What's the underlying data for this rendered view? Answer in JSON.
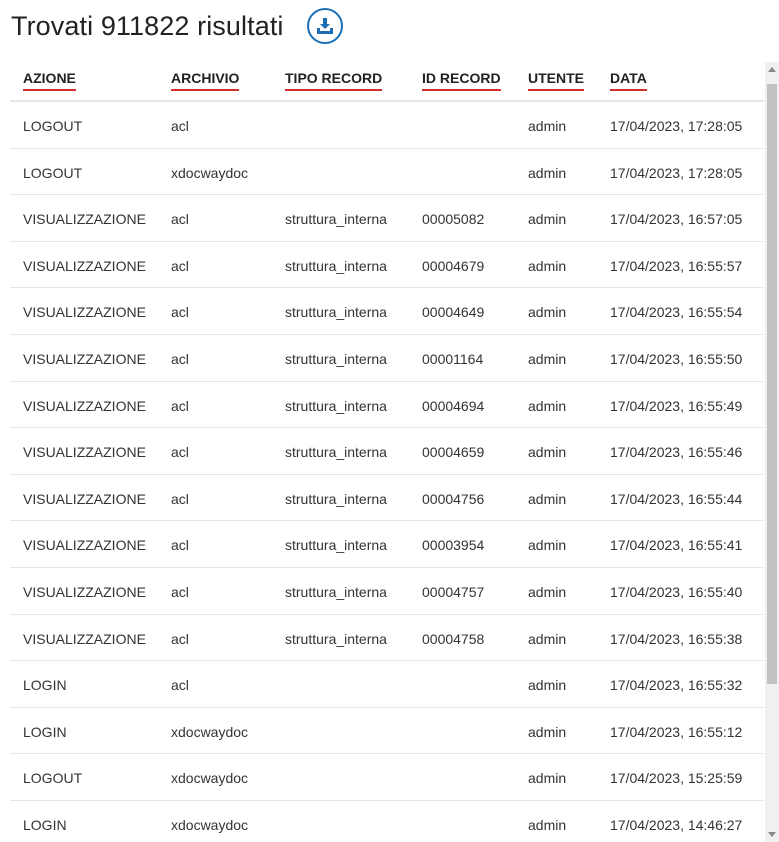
{
  "header": {
    "title": "Trovati 911822 risultati",
    "download_icon": "download-icon"
  },
  "table": {
    "columns": [
      "AZIONE",
      "ARCHIVIO",
      "TIPO RECORD",
      "ID RECORD",
      "UTENTE",
      "DATA"
    ],
    "rows": [
      [
        "LOGOUT",
        "acl",
        "",
        "",
        "admin",
        "17/04/2023, 17:28:05"
      ],
      [
        "LOGOUT",
        "xdocwaydoc",
        "",
        "",
        "admin",
        "17/04/2023, 17:28:05"
      ],
      [
        "VISUALIZZAZIONE",
        "acl",
        "struttura_interna",
        "00005082",
        "admin",
        "17/04/2023, 16:57:05"
      ],
      [
        "VISUALIZZAZIONE",
        "acl",
        "struttura_interna",
        "00004679",
        "admin",
        "17/04/2023, 16:55:57"
      ],
      [
        "VISUALIZZAZIONE",
        "acl",
        "struttura_interna",
        "00004649",
        "admin",
        "17/04/2023, 16:55:54"
      ],
      [
        "VISUALIZZAZIONE",
        "acl",
        "struttura_interna",
        "00001164",
        "admin",
        "17/04/2023, 16:55:50"
      ],
      [
        "VISUALIZZAZIONE",
        "acl",
        "struttura_interna",
        "00004694",
        "admin",
        "17/04/2023, 16:55:49"
      ],
      [
        "VISUALIZZAZIONE",
        "acl",
        "struttura_interna",
        "00004659",
        "admin",
        "17/04/2023, 16:55:46"
      ],
      [
        "VISUALIZZAZIONE",
        "acl",
        "struttura_interna",
        "00004756",
        "admin",
        "17/04/2023, 16:55:44"
      ],
      [
        "VISUALIZZAZIONE",
        "acl",
        "struttura_interna",
        "00003954",
        "admin",
        "17/04/2023, 16:55:41"
      ],
      [
        "VISUALIZZAZIONE",
        "acl",
        "struttura_interna",
        "00004757",
        "admin",
        "17/04/2023, 16:55:40"
      ],
      [
        "VISUALIZZAZIONE",
        "acl",
        "struttura_interna",
        "00004758",
        "admin",
        "17/04/2023, 16:55:38"
      ],
      [
        "LOGIN",
        "acl",
        "",
        "",
        "admin",
        "17/04/2023, 16:55:32"
      ],
      [
        "LOGIN",
        "xdocwaydoc",
        "",
        "",
        "admin",
        "17/04/2023, 16:55:12"
      ],
      [
        "LOGOUT",
        "xdocwaydoc",
        "",
        "",
        "admin",
        "17/04/2023, 15:25:59"
      ],
      [
        "LOGIN",
        "xdocwaydoc",
        "",
        "",
        "admin",
        "17/04/2023, 14:46:27"
      ]
    ]
  },
  "colors": {
    "accent": "#1a6fb5",
    "header_underline": "#d32f2f",
    "row_border": "#e6e6e6"
  }
}
